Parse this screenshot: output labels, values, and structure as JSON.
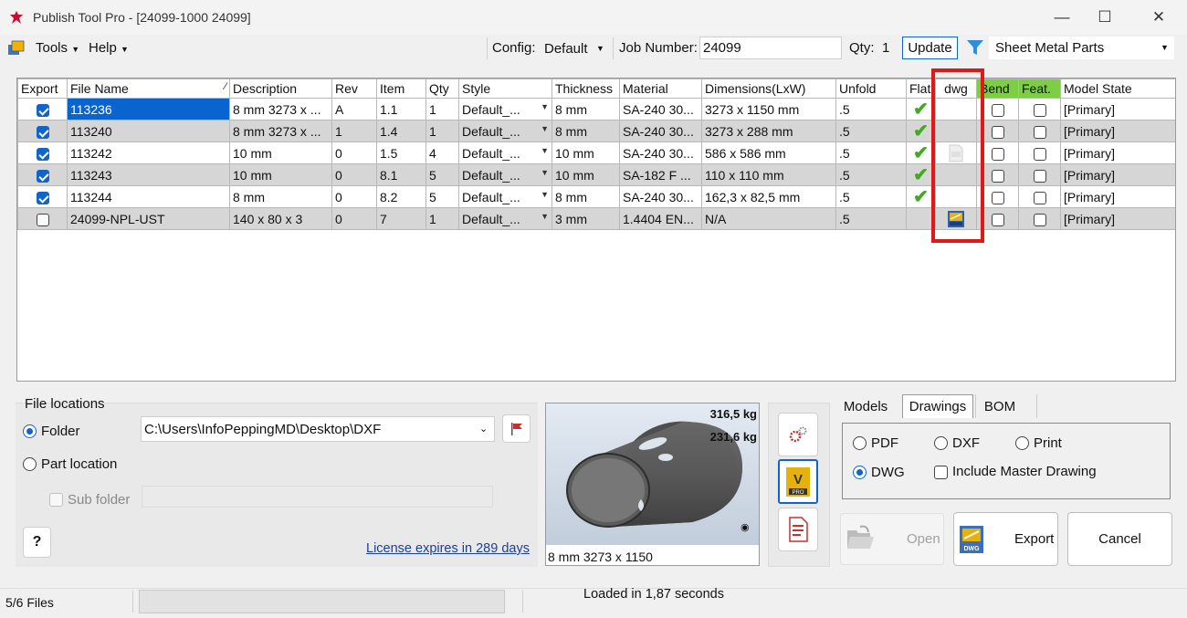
{
  "window": {
    "title": "Publish Tool Pro - [24099-1000 24099]",
    "minimize": "—",
    "maximize": "☐",
    "close": "✕"
  },
  "menu": {
    "tools": "Tools",
    "help": "Help"
  },
  "toolbar": {
    "config_label": "Config:",
    "config_value": "Default",
    "job_label": "Job Number:",
    "job_value": "24099",
    "qty_label": "Qty:",
    "qty_value": "1",
    "update_label": "Update",
    "filter_value": "Sheet Metal Parts"
  },
  "grid": {
    "columns": [
      "Export",
      "File Name",
      "Description",
      "Rev",
      "Item",
      "Qty",
      "Style",
      "Thickness",
      "Material",
      "Dimensions(LxW)",
      "Unfold",
      "Flat",
      "dwg",
      "Bend",
      "Feat.",
      "Model State"
    ],
    "rows": [
      {
        "export": true,
        "file": "113236",
        "desc": "8 mm 3273 x ...",
        "rev": "A",
        "item": "1.1",
        "qty": "1",
        "style": "Default_...",
        "thick": "8 mm",
        "mat": "SA-240 30...",
        "dim": "3273 x 1150 mm",
        "unfold": ".5",
        "flat": true,
        "dwg": "none",
        "state": "[Primary]"
      },
      {
        "export": true,
        "file": "113240",
        "desc": "8 mm 3273 x ...",
        "rev": "1",
        "item": "1.4",
        "qty": "1",
        "style": "Default_...",
        "thick": "8 mm",
        "mat": "SA-240 30...",
        "dim": "3273 x 288 mm",
        "unfold": ".5",
        "flat": true,
        "dwg": "none",
        "state": "[Primary]"
      },
      {
        "export": true,
        "file": "113242",
        "desc": "10 mm",
        "rev": "0",
        "item": "1.5",
        "qty": "4",
        "style": "Default_...",
        "thick": "10 mm",
        "mat": "SA-240 30...",
        "dim": "586 x 586 mm",
        "unfold": ".5",
        "flat": true,
        "dwg": "faded",
        "state": "[Primary]"
      },
      {
        "export": true,
        "file": "113243",
        "desc": "10 mm",
        "rev": "0",
        "item": "8.1",
        "qty": "5",
        "style": "Default_...",
        "thick": "10 mm",
        "mat": "SA-182 F ...",
        "dim": "110 x 110 mm",
        "unfold": ".5",
        "flat": true,
        "dwg": "none",
        "state": "[Primary]"
      },
      {
        "export": true,
        "file": "113244",
        "desc": "8 mm",
        "rev": "0",
        "item": "8.2",
        "qty": "5",
        "style": "Default_...",
        "thick": "8 mm",
        "mat": "SA-240 30...",
        "dim": "162,3 x 82,5 mm",
        "unfold": ".5",
        "flat": true,
        "dwg": "none",
        "state": "[Primary]"
      },
      {
        "export": false,
        "file": "24099-NPL-UST",
        "desc": "140 x 80 x 3",
        "rev": "0",
        "item": "7",
        "qty": "1",
        "style": "Default_...",
        "thick": "3 mm",
        "mat": "1.4404 EN...",
        "dim": "N/A",
        "unfold": ".5",
        "flat": false,
        "dwg": "icon",
        "state": "[Primary]"
      }
    ]
  },
  "file_locations": {
    "title": "File locations",
    "folder_label": "Folder",
    "part_location_label": "Part location",
    "path": "C:\\Users\\InfoPeppingMD\\Desktop\\DXF",
    "subfolder_label": "Sub folder",
    "help_label": "?",
    "license": "License expires in 289 days"
  },
  "preview": {
    "weight1": "316,5 kg",
    "weight2": "231,6 kg",
    "caption": "8 mm 3273 x 1150"
  },
  "tabs": {
    "models": "Models",
    "drawings": "Drawings",
    "bom": "BOM"
  },
  "formats": {
    "pdf": "PDF",
    "dxf": "DXF",
    "print": "Print",
    "dwg": "DWG",
    "master": "Include Master Drawing"
  },
  "actions": {
    "open": "Open",
    "export": "Export",
    "cancel": "Cancel"
  },
  "status": {
    "files": "5/6 Files",
    "loaded": "Loaded in 1,87 seconds"
  },
  "colors": {
    "accent": "#0a64d0",
    "header_green": "#7ccf45",
    "highlight_red": "#e01818"
  }
}
